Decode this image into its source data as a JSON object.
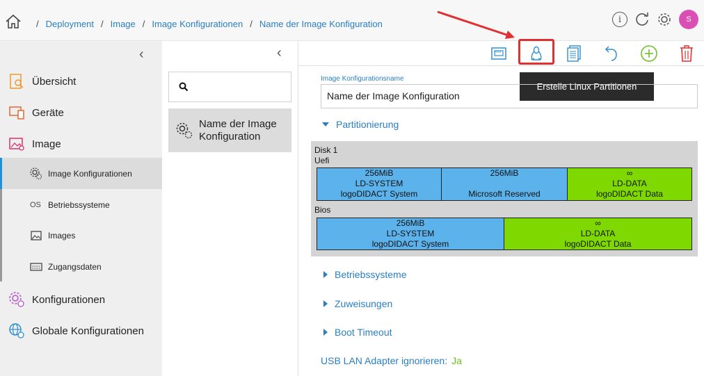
{
  "breadcrumb": {
    "items": [
      "Deployment",
      "Image",
      "Image Konfigurationen",
      "Name der Image Konfiguration"
    ]
  },
  "user": {
    "initial": "S",
    "avatar_color": "#d94fb4"
  },
  "sidebar": {
    "items": [
      {
        "label": "Übersicht",
        "icon": "overview-icon"
      },
      {
        "label": "Geräte",
        "icon": "devices-icon"
      },
      {
        "label": "Image",
        "icon": "image-icon"
      },
      {
        "label": "Konfigurationen",
        "icon": "configurations-icon"
      },
      {
        "label": "Globale Konfigurationen",
        "icon": "global-configurations-icon"
      }
    ],
    "subitems": [
      {
        "label": "Image Konfigurationen",
        "icon": "gears-icon",
        "active": true
      },
      {
        "label": "Betriebssysteme",
        "icon_text": "OS",
        "active": false
      },
      {
        "label": "Images",
        "icon": "images-icon",
        "active": false
      },
      {
        "label": "Zugangsdaten",
        "icon": "credentials-icon",
        "active": false
      }
    ]
  },
  "list": {
    "search_placeholder": "",
    "selected_item": "Name der Image Konfiguration"
  },
  "toolbar": {
    "tooltip": "Erstelle Linux Partitionen",
    "buttons": [
      "network-icon",
      "linux-icon",
      "document-icon",
      "undo-icon",
      "add-icon",
      "delete-icon"
    ]
  },
  "form": {
    "name_label": "Image Konfigurationsname",
    "name_value": "Name der Image Konfiguration",
    "section_partitioning": "Partitionierung",
    "disk_title": "Disk 1",
    "uefi_label": "Uefi",
    "bios_label": "Bios",
    "uefi_partitions": [
      {
        "size": "256MiB",
        "name": "LD-SYSTEM",
        "desc": "logoDIDACT System",
        "color": "#5cb2ea"
      },
      {
        "size": "256MiB",
        "name": "",
        "desc": "Microsoft Reserved",
        "color": "#5cb2ea"
      },
      {
        "size": "∞",
        "name": "LD-DATA",
        "desc": "logoDIDACT Data",
        "color": "#7fd900"
      }
    ],
    "bios_partitions": [
      {
        "size": "256MiB",
        "name": "LD-SYSTEM",
        "desc": "logoDIDACT System",
        "color": "#5cb2ea"
      },
      {
        "size": "∞",
        "name": "LD-DATA",
        "desc": "logoDIDACT Data",
        "color": "#7fd900"
      }
    ],
    "section_os": "Betriebssysteme",
    "section_assignments": "Zuweisungen",
    "section_boot": "Boot Timeout",
    "usb_label": "USB LAN Adapter ignorieren:",
    "usb_value": "Ja"
  }
}
